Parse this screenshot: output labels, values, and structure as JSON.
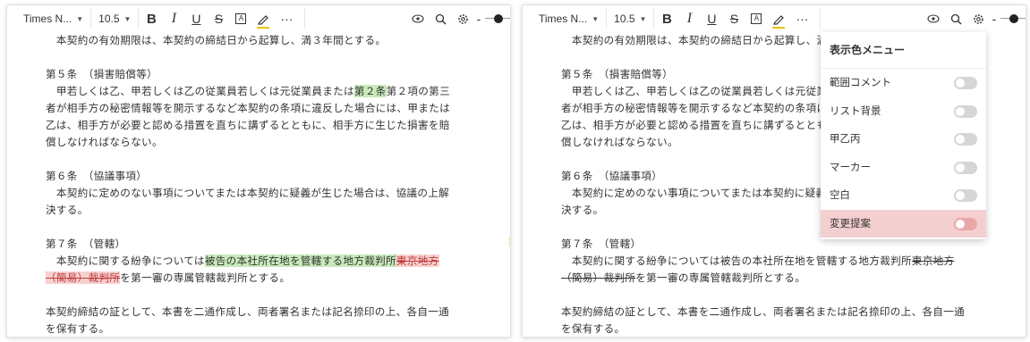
{
  "toolbar": {
    "font_name": "Times N...",
    "font_size": "10.5",
    "more_label": "···",
    "zoom_minus": "-"
  },
  "document": {
    "line_top": "本契約の有効期限は、本契約の締結日から起算し、満３年間とする。",
    "article5": {
      "title": "第５条　（損害賠償等）",
      "l1_a": "　甲若しくは乙、甲若しくは乙の従業員若しくは元従業員または",
      "l1_hl": "第２条",
      "l1_b": "第２項の第三",
      "l2": "者が相手方の秘密情報等を開示するなど本契約の条項に違反した場合には、甲または",
      "l3": "乙は、相手方が必要と認める措置を直ちに講ずるとともに、相手方に生じた損害を賠",
      "l4": "償しなければならない。"
    },
    "article6": {
      "title": "第６条　（協議事項）",
      "l1": "　本契約に定めのない事項についてまたは本契約に疑義が生じた場合は、協議の上解",
      "l2": "決する。"
    },
    "article7": {
      "title": "第７条　（管轄）",
      "l1_a": "　本契約に関する紛争については",
      "l1_ins": "被告の本社所在地を管轄する地方裁判所",
      "l1_del": "東京地方",
      "l2_del": "（簡易）裁判所",
      "l2_b": "を第一審の専属管轄裁判所とする。"
    },
    "closing": {
      "l1": "本契約締結の証として、本書を二通作成し、両者署名または記名捺印の上、各自一通",
      "l2": "を保有する。"
    }
  },
  "menu": {
    "title": "表示色メニュー",
    "items": [
      {
        "label": "範囲コメント",
        "on": false
      },
      {
        "label": "リスト背景",
        "on": false
      },
      {
        "label": "甲乙丙",
        "on": false
      },
      {
        "label": "マーカー",
        "on": false
      },
      {
        "label": "空白",
        "on": false
      },
      {
        "label": "変更提案",
        "on": false,
        "selected": true
      }
    ]
  },
  "colors": {
    "insert_highlight": "#c8eabb",
    "deletion": "#c23b3b",
    "deletion_bg": "#f7d1d1",
    "selected_menu_bg": "#f4cfd0",
    "pen_underline": "#e8c100"
  }
}
